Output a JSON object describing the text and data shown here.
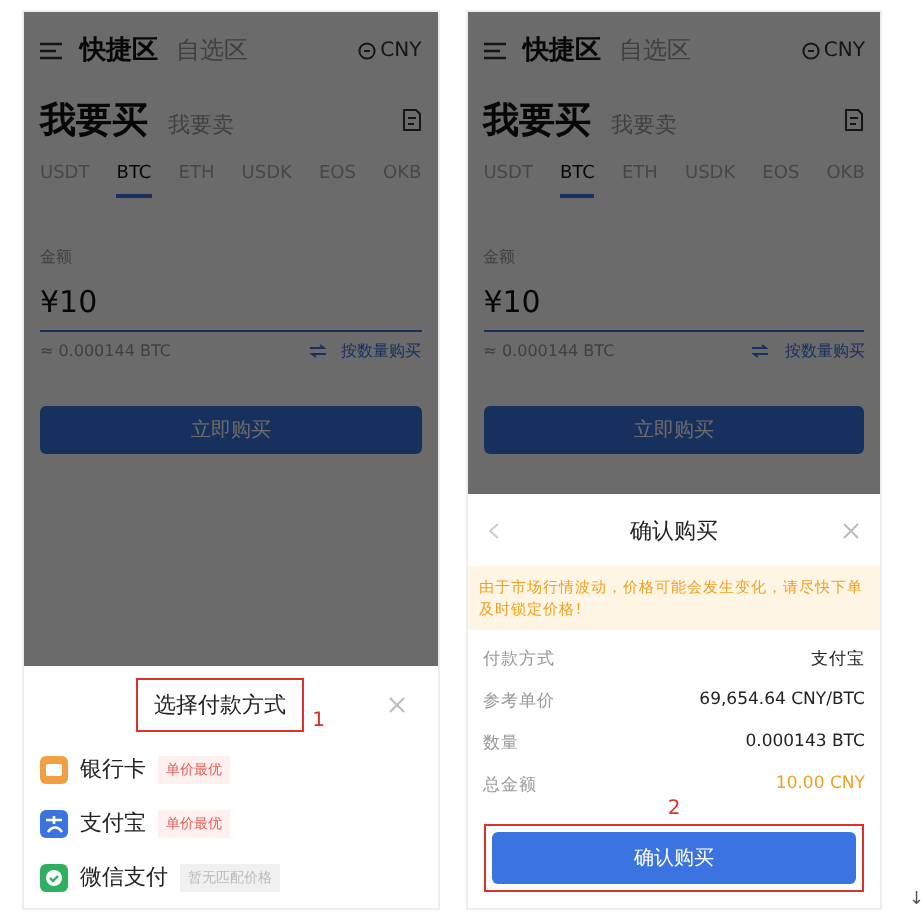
{
  "screens": [
    {
      "nav_tabs": [
        {
          "label": "快捷区",
          "selected": true
        },
        {
          "label": "自选区",
          "selected": false
        }
      ],
      "currency": "CNY",
      "trade_tabs": [
        {
          "label": "我要买",
          "selected": true
        },
        {
          "label": "我要卖",
          "selected": false
        }
      ],
      "coins": [
        {
          "label": "USDT",
          "selected": false
        },
        {
          "label": "BTC",
          "selected": true
        },
        {
          "label": "ETH",
          "selected": false
        },
        {
          "label": "USDK",
          "selected": false
        },
        {
          "label": "EOS",
          "selected": false
        },
        {
          "label": "OKB",
          "selected": false
        }
      ],
      "amount": {
        "label": "金额",
        "value": "¥10"
      },
      "estimate": "≈ 0.000144 BTC",
      "switch_link": "按数量购买",
      "buy_button": "立即购买",
      "sheet": {
        "kind": "payment",
        "title": "选择付款方式",
        "annotation": "1",
        "methods": [
          {
            "name": "银行卡",
            "color": "#f0a040",
            "badge": "单价最优",
            "disabled": false
          },
          {
            "name": "支付宝",
            "color": "#3b73e0",
            "badge": "单价最优",
            "disabled": false
          },
          {
            "name": "微信支付",
            "color": "#2fb060",
            "badge": "暂无匹配价格",
            "disabled": true
          }
        ]
      }
    },
    {
      "nav_tabs": [
        {
          "label": "快捷区",
          "selected": true
        },
        {
          "label": "自选区",
          "selected": false
        }
      ],
      "currency": "CNY",
      "trade_tabs": [
        {
          "label": "我要买",
          "selected": true
        },
        {
          "label": "我要卖",
          "selected": false
        }
      ],
      "coins": [
        {
          "label": "USDT",
          "selected": false
        },
        {
          "label": "BTC",
          "selected": true
        },
        {
          "label": "ETH",
          "selected": false
        },
        {
          "label": "USDK",
          "selected": false
        },
        {
          "label": "EOS",
          "selected": false
        },
        {
          "label": "OKB",
          "selected": false
        }
      ],
      "amount": {
        "label": "金额",
        "value": "¥10"
      },
      "estimate": "≈ 0.000144 BTC",
      "switch_link": "按数量购买",
      "buy_button": "立即购买",
      "sheet": {
        "kind": "confirm",
        "title": "确认购买",
        "notice": "由于市场行情波动，价格可能会发生变化，请尽快下单及时锁定价格!",
        "rows": [
          {
            "label": "付款方式",
            "value": "支付宝",
            "highlight": false
          },
          {
            "label": "参考单价",
            "value": "69,654.64 CNY/BTC",
            "highlight": false
          },
          {
            "label": "数量",
            "value": "0.000143 BTC",
            "highlight": false
          },
          {
            "label": "总金额",
            "value": "10.00 CNY",
            "highlight": true
          }
        ],
        "annotation": "2",
        "button": "确认购买"
      }
    }
  ],
  "corner_mark": "↓"
}
